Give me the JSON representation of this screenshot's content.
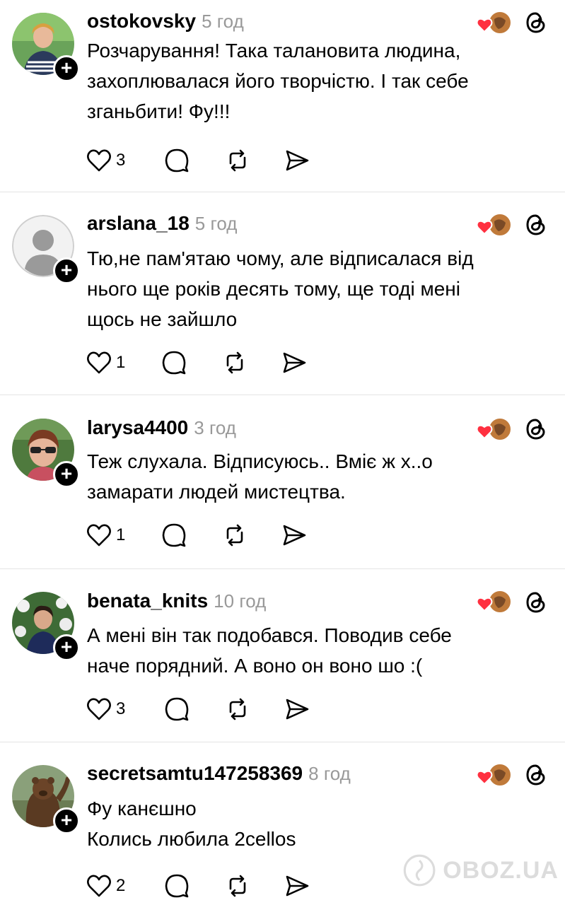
{
  "posts": [
    {
      "username": "ostokovsky",
      "time": "5 год",
      "text": "Розчарування! Така талановита людина,\nзахоплювалася його творчістю. І так себе\nзганьбити! Фу!!!",
      "likes": "3",
      "avatar": "photo-woman-striped-shirt"
    },
    {
      "username": "arslana_18",
      "time": "5 год",
      "text": "Тю,не пам'ятаю чому, але відписалася від\nнього ще років десять тому, ще тоді мені\nщось не зайшло",
      "likes": "1",
      "avatar": "default-avatar"
    },
    {
      "username": "larysa4400",
      "time": "3 год",
      "text": "Теж слухала. Відписуюсь.. Вміє ж х..о\nзамарати людей мистецтва.",
      "likes": "1",
      "avatar": "photo-woman-sunglasses"
    },
    {
      "username": "benata_knits",
      "time": "10 год",
      "text": "А мені він так подобався. Поводив себе\nначе порядний. А воно он воно шо :(",
      "likes": "3",
      "avatar": "photo-woman-flowers"
    },
    {
      "username": "secretsamtu147258369",
      "time": "8 год",
      "text": "Фу канєшно\nКолись любила 2cellos",
      "likes": "2",
      "avatar": "photo-bear-waving"
    }
  ],
  "watermark": "OBOZ.UA",
  "colors": {
    "heart": "#ff3040",
    "secondary_text": "#999999",
    "divider": "#e4e4e4"
  }
}
